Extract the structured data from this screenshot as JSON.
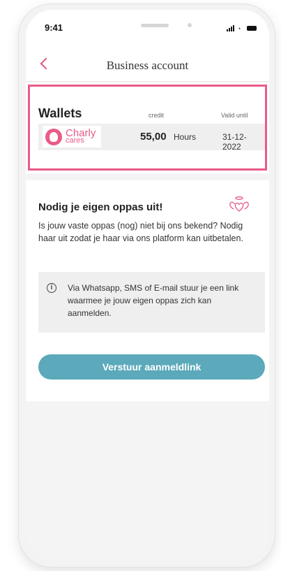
{
  "status_bar": {
    "time": "9:41"
  },
  "header": {
    "title": "Business account",
    "back_icon": "chevron-left-icon"
  },
  "wallets": {
    "title": "Wallets",
    "columns": {
      "credit": "credit",
      "valid_until": "Valid until"
    },
    "rows": [
      {
        "provider_logo": {
          "line1": "Charly",
          "line2": "cares"
        },
        "amount": "55,00",
        "unit": "Hours",
        "valid_until": "31-12-2022"
      }
    ],
    "frame_color": "#ea5b87"
  },
  "invite": {
    "title": "Nodig je eigen oppas uit!",
    "body": "Is jouw vaste oppas (nog) niet bij ons bekend? Nodig haar uit zodat je haar via ons platform kan uitbetalen.",
    "info": "Via Whatsapp, SMS of E-mail stuur je een link waarmee je jouw eigen oppas zich kan aanmelden.",
    "button_label": "Verstuur aanmeldlink",
    "button_color": "#5ba9ba"
  }
}
